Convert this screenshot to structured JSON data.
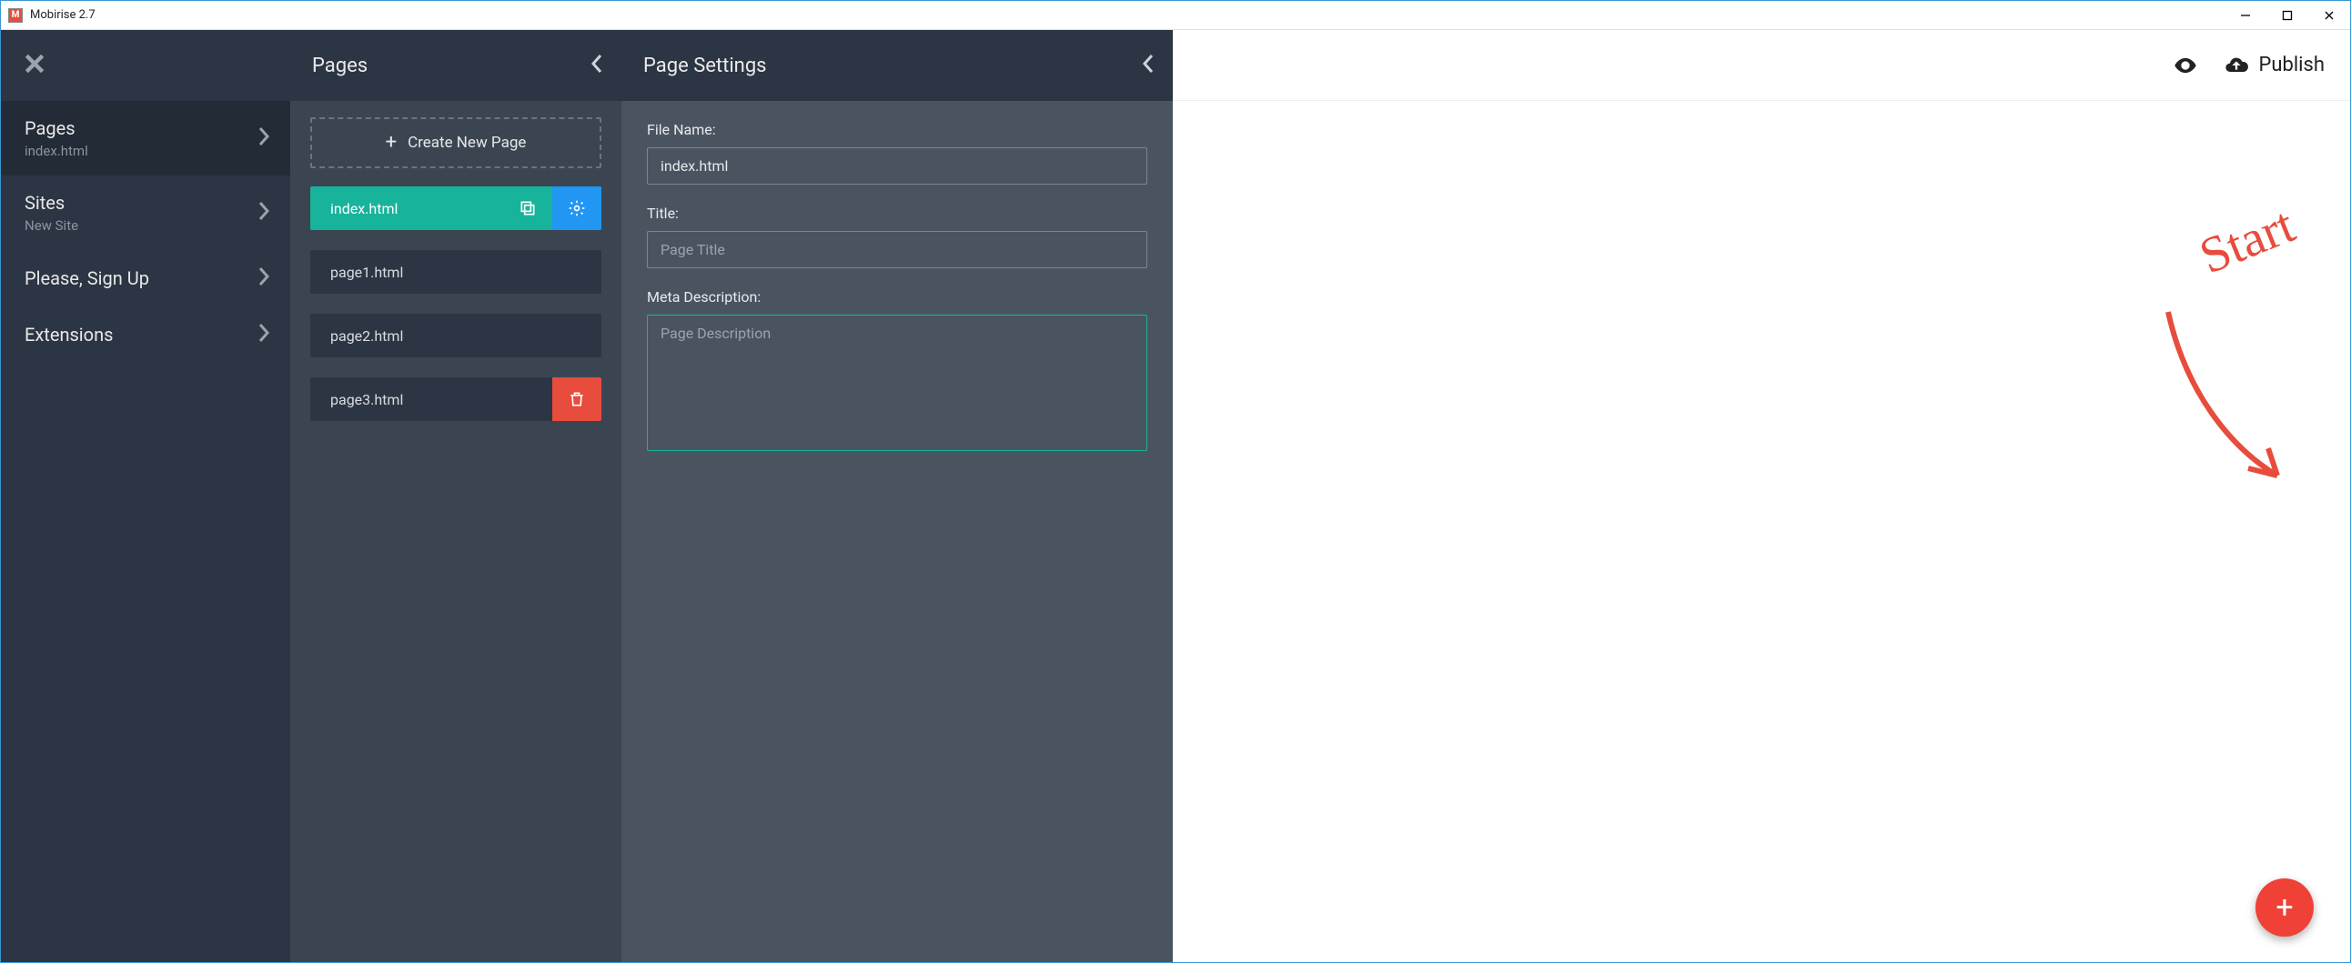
{
  "titlebar": {
    "app_name": "Mobirise 2.7"
  },
  "sidebar": {
    "items": [
      {
        "title": "Pages",
        "subtitle": "index.html"
      },
      {
        "title": "Sites",
        "subtitle": "New Site"
      },
      {
        "title": "Please, Sign Up",
        "subtitle": ""
      },
      {
        "title": "Extensions",
        "subtitle": ""
      }
    ]
  },
  "pages_panel": {
    "header": "Pages",
    "create_label": "Create New Page",
    "pages": [
      {
        "name": "index.html",
        "active": true
      },
      {
        "name": "page1.html",
        "active": false
      },
      {
        "name": "page2.html",
        "active": false
      },
      {
        "name": "page3.html",
        "active": false,
        "show_trash": true
      }
    ]
  },
  "settings_panel": {
    "header": "Page Settings",
    "filename_label": "File Name:",
    "filename_value": "index.html",
    "title_label": "Title:",
    "title_placeholder": "Page Title",
    "meta_label": "Meta Description:",
    "meta_placeholder": "Page Description"
  },
  "topbar": {
    "publish_label": "Publish"
  },
  "canvas": {
    "annotation_text": "Start"
  }
}
